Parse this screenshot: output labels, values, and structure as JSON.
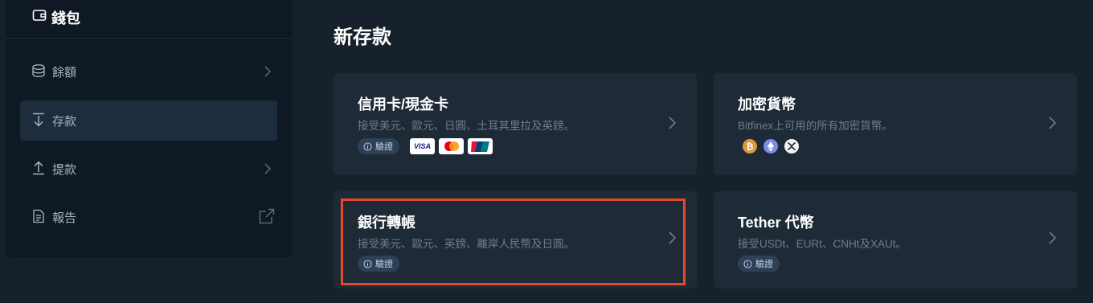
{
  "sidebar": {
    "title": "錢包",
    "items": [
      {
        "label": "餘額"
      },
      {
        "label": "存款"
      },
      {
        "label": "提款"
      },
      {
        "label": "報告"
      }
    ]
  },
  "main": {
    "title": "新存款",
    "cards": [
      {
        "title": "信用卡/現金卡",
        "desc": "接受美元、歐元、日圓、土耳其里拉及英鎊。",
        "badge": "驗證",
        "payment_logos": [
          "visa-logo",
          "mastercard-logo",
          "unionpay-logo"
        ]
      },
      {
        "title": "加密貨幣",
        "desc": "Bitfinex上可用的所有加密貨幣。",
        "crypto_icons": [
          "bitcoin-icon",
          "ethereum-icon",
          "xrp-icon"
        ]
      },
      {
        "title": "銀行轉帳",
        "desc": "接受美元、歐元、英鎊、離岸人民幣及日圓。",
        "badge": "驗證"
      },
      {
        "title": "Tether 代幣",
        "desc": "接受USDt、EURt、CNHt及XAUt。",
        "badge": "驗證"
      }
    ]
  },
  "colors": {
    "background": "#17212b",
    "sidebar": "#0f1923",
    "card": "#1e2a36",
    "badge": "#2d4057",
    "highlight": "#e24a2b"
  },
  "visa_text": "VISA"
}
